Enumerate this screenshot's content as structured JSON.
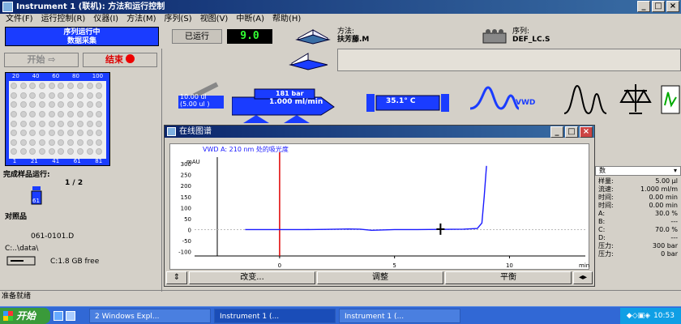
{
  "window": {
    "title": "Instrument 1 (联机): 方法和运行控制",
    "min": "_",
    "max": "□",
    "close": "×"
  },
  "menu": [
    "文件(F)",
    "运行控制(R)",
    "仪器(I)",
    "方法(M)",
    "序列(S)",
    "视图(V)",
    "中断(A)",
    "帮助(H)"
  ],
  "status": {
    "line1": "序列运行中",
    "line2": "数据采集"
  },
  "run": {
    "label": "已运行",
    "value": "9.0"
  },
  "method": {
    "label": "方法:",
    "value": "扶芳藤.M"
  },
  "sequence": {
    "label": "序列:",
    "value": "DEF_LC.S"
  },
  "buttons": {
    "start": "开始",
    "stop": "结束"
  },
  "tray": {
    "top": [
      "20",
      "40",
      "60",
      "80",
      "100"
    ],
    "bottom": [
      "1",
      "21",
      "41",
      "61",
      "81"
    ]
  },
  "completed": {
    "label": "完成样品运行:",
    "value": "1 / 2",
    "vial": "61"
  },
  "reference": {
    "label": "对照品"
  },
  "file": {
    "name": "061-0101.D",
    "path": "C:..\\data\\",
    "disk": "C:1.8 GB free"
  },
  "pump": {
    "pressure": "181 bar",
    "flow": "1.000 ml/min"
  },
  "injector": {
    "line1": "10.00 ul",
    "line2": "(5.00 ul )"
  },
  "column": {
    "temp": "35.1° C"
  },
  "detector": {
    "label": "VWD"
  },
  "plot": {
    "title": "在线图谱",
    "signal": "VWD A: 210 nm 处的吸光度",
    "ylabel": "mAU",
    "yticks": [
      "300",
      "250",
      "200",
      "150",
      "100",
      "50",
      "0",
      "-50",
      "-100"
    ],
    "xticks": [
      "0",
      "5",
      "10"
    ],
    "xunit": "min",
    "buttons": [
      "改变...",
      "调整",
      "平衡"
    ]
  },
  "chart_data": {
    "type": "line",
    "title": "",
    "xlabel": "min",
    "ylabel": "mAU",
    "xlim": [
      -3.7,
      13.3
    ],
    "ylim": [
      -120,
      330
    ],
    "x": [
      -1.5,
      0,
      1,
      2,
      3,
      3.5,
      4,
      5,
      6,
      7,
      8,
      8.6,
      8.8,
      8.9,
      9.0
    ],
    "series": [
      {
        "values": [
          0,
          0,
          0,
          1,
          3,
          2,
          -3,
          0,
          0,
          1,
          2,
          5,
          30,
          150,
          290
        ]
      }
    ],
    "marker_x": 0,
    "colors": {
      "trace": "#1a1aff",
      "marker": "#e00000"
    }
  },
  "params": {
    "header": "数",
    "rows": [
      [
        "样量:",
        "5.00 μl"
      ],
      [
        "流速:",
        "1.000 ml/m"
      ],
      [
        "时间:",
        "0.00 min"
      ],
      [
        "时间:",
        "0.00 min"
      ],
      [
        "A:",
        "30.0 %"
      ],
      [
        "B:",
        "---"
      ],
      [
        "C:",
        "70.0 %"
      ],
      [
        "D:",
        "---"
      ],
      [
        "压力:",
        "300 bar"
      ],
      [
        "压力:",
        "0 bar"
      ]
    ]
  },
  "statusbar": {
    "text": "准备就绪"
  },
  "taskbar": {
    "start": "开始",
    "items": [
      "2 Windows Expl...",
      "Instrument 1 (...",
      "Instrument 1 (..."
    ],
    "clock": "10:53"
  }
}
